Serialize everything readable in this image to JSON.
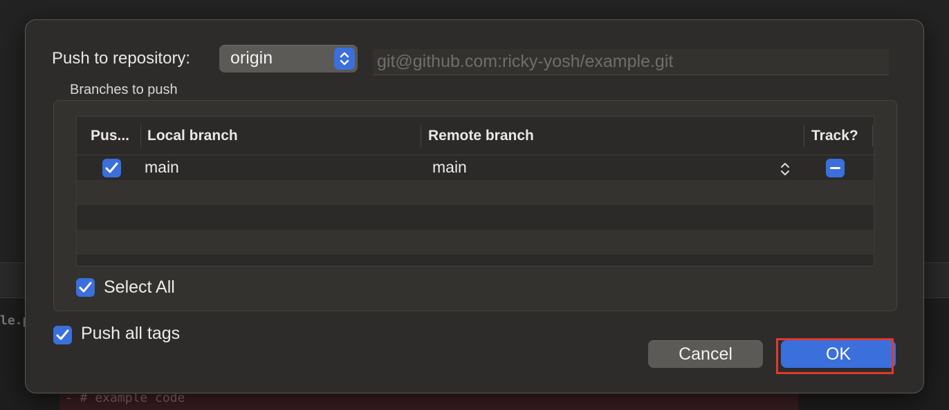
{
  "background": {
    "file_label": "le.p",
    "diff_line": "- # example code"
  },
  "dialog": {
    "repo_label": "Push to repository:",
    "repo_selected": "origin",
    "repo_url": "git@github.com:ricky-yosh/example.git",
    "branches_label": "Branches to push",
    "table": {
      "headers": [
        "Pus...",
        "Local branch",
        "Remote branch",
        "Track?"
      ],
      "rows": [
        {
          "push": true,
          "local": "main",
          "remote": "main",
          "track": "mixed"
        }
      ]
    },
    "select_all": {
      "label": "Select All",
      "checked": true
    },
    "push_all_tags": {
      "label": "Push all tags",
      "checked": true
    },
    "buttons": {
      "cancel": "Cancel",
      "ok": "OK"
    }
  },
  "colors": {
    "accent": "#3b6fdc",
    "highlight": "#e03a2e"
  }
}
